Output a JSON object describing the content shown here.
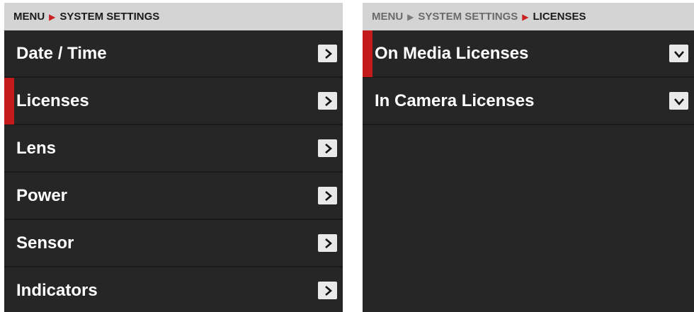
{
  "left": {
    "breadcrumb": {
      "root": "MENU",
      "current": "SYSTEM SETTINGS"
    },
    "items": [
      {
        "label": "Date / Time",
        "selected": false
      },
      {
        "label": "Licenses",
        "selected": true
      },
      {
        "label": "Lens",
        "selected": false
      },
      {
        "label": "Power",
        "selected": false
      },
      {
        "label": "Sensor",
        "selected": false
      },
      {
        "label": "Indicators",
        "selected": false
      }
    ]
  },
  "right": {
    "breadcrumb": {
      "root": "MENU",
      "middle": "SYSTEM SETTINGS",
      "current": "LICENSES"
    },
    "items": [
      {
        "label": "On Media Licenses",
        "selected": true
      },
      {
        "label": "In Camera Licenses",
        "selected": false
      }
    ]
  },
  "colors": {
    "accent": "#c31b1b",
    "panel_bg": "#262626",
    "breadcrumb_bg": "#d4d4d4"
  },
  "icons": {
    "row_action_left": "chevron-right-icon",
    "row_action_right": "chevron-down-icon",
    "breadcrumb_separator": "caret-right-icon"
  }
}
